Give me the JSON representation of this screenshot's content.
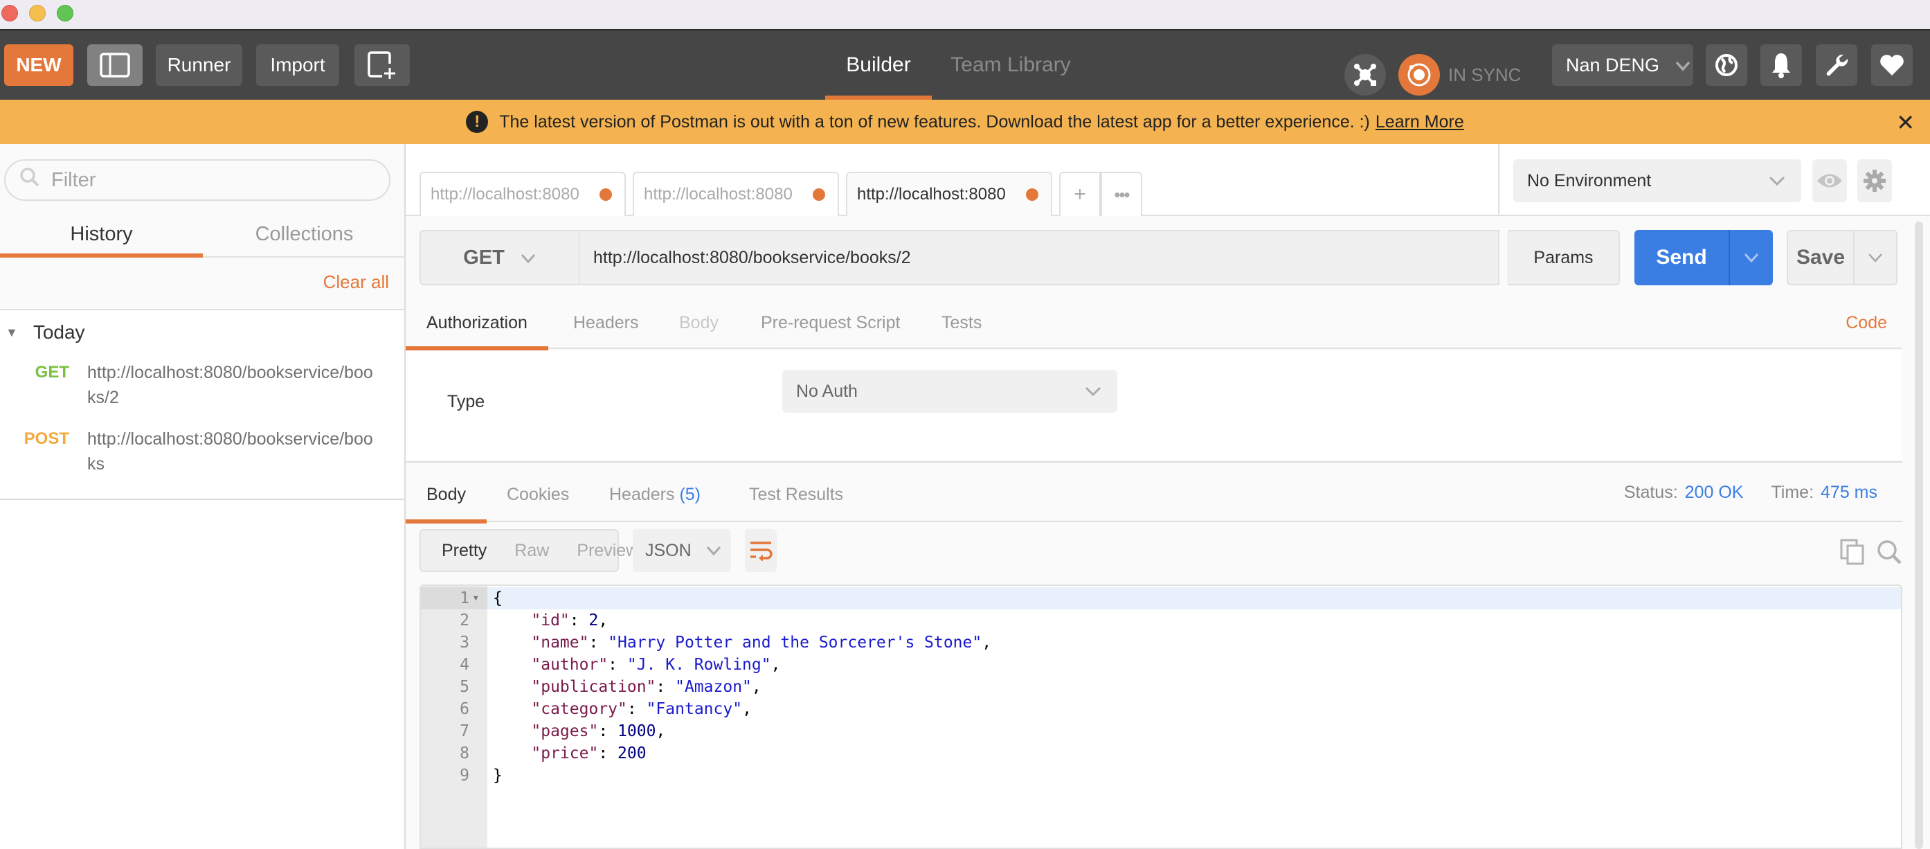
{
  "window": {
    "traffic_lights": [
      "close",
      "minimize",
      "maximize"
    ]
  },
  "toolbar": {
    "new_label": "NEW",
    "runner_label": "Runner",
    "import_label": "Import",
    "nav_tabs": [
      {
        "label": "Builder",
        "active": true
      },
      {
        "label": "Team Library",
        "active": false
      }
    ],
    "sync_status": "IN SYNC",
    "user_name": "Nan DENG",
    "icons": [
      "sidebar-toggle-icon",
      "new-window-icon",
      "interceptor-icon",
      "sync-icon",
      "globe-icon",
      "bell-icon",
      "wrench-icon",
      "heart-icon"
    ]
  },
  "banner": {
    "message": "The latest version of Postman is out with a ton of new features. Download the latest app for a better experience. :)",
    "link_label": "Learn More",
    "close_glyph": "✕",
    "warn_glyph": "!"
  },
  "sidebar": {
    "filter_placeholder": "Filter",
    "tabs": [
      {
        "label": "History",
        "active": true
      },
      {
        "label": "Collections",
        "active": false
      }
    ],
    "clear_all_label": "Clear all",
    "group_label": "Today",
    "history": [
      {
        "method": "GET",
        "url": "http://localhost:8080/bookservice/books/2"
      },
      {
        "method": "POST",
        "url": "http://localhost:8080/bookservice/books"
      }
    ]
  },
  "request_tabs": [
    {
      "label": "http://localhost:8080",
      "unsaved": true,
      "active": false
    },
    {
      "label": "http://localhost:8080",
      "unsaved": true,
      "active": false
    },
    {
      "label": "http://localhost:8080",
      "unsaved": true,
      "active": true
    }
  ],
  "tab_actions": {
    "add": "+",
    "more": "•••"
  },
  "environment": {
    "selected": "No Environment"
  },
  "request": {
    "method": "GET",
    "url": "http://localhost:8080/bookservice/books/2",
    "params_label": "Params",
    "send_label": "Send",
    "save_label": "Save",
    "tabs": [
      {
        "label": "Authorization",
        "state": "active"
      },
      {
        "label": "Headers",
        "state": "normal"
      },
      {
        "label": "Body",
        "state": "disabled"
      },
      {
        "label": "Pre-request Script",
        "state": "normal"
      },
      {
        "label": "Tests",
        "state": "normal"
      }
    ],
    "code_label": "Code",
    "auth": {
      "type_label": "Type",
      "type_value": "No Auth"
    }
  },
  "response": {
    "tabs": [
      {
        "label": "Body",
        "active": true,
        "count": null
      },
      {
        "label": "Cookies",
        "active": false,
        "count": null
      },
      {
        "label": "Headers",
        "active": false,
        "count": "(5)"
      },
      {
        "label": "Test Results",
        "active": false,
        "count": null
      }
    ],
    "status_label": "Status:",
    "status_value": "200 OK",
    "time_label": "Time:",
    "time_value": "475 ms",
    "format_options": [
      {
        "label": "Pretty",
        "active": true
      },
      {
        "label": "Raw",
        "active": false
      },
      {
        "label": "Preview",
        "active": false
      }
    ],
    "language": "JSON",
    "body_lines": [
      {
        "n": "1",
        "tokens": [
          {
            "t": "p",
            "v": "{"
          }
        ]
      },
      {
        "n": "2",
        "tokens": [
          {
            "t": "p",
            "v": "    "
          },
          {
            "t": "k",
            "v": "\"id\""
          },
          {
            "t": "p",
            "v": ": "
          },
          {
            "t": "n",
            "v": "2"
          },
          {
            "t": "p",
            "v": ","
          }
        ]
      },
      {
        "n": "3",
        "tokens": [
          {
            "t": "p",
            "v": "    "
          },
          {
            "t": "k",
            "v": "\"name\""
          },
          {
            "t": "p",
            "v": ": "
          },
          {
            "t": "s",
            "v": "\"Harry Potter and the Sorcerer's Stone\""
          },
          {
            "t": "p",
            "v": ","
          }
        ]
      },
      {
        "n": "4",
        "tokens": [
          {
            "t": "p",
            "v": "    "
          },
          {
            "t": "k",
            "v": "\"author\""
          },
          {
            "t": "p",
            "v": ": "
          },
          {
            "t": "s",
            "v": "\"J. K. Rowling\""
          },
          {
            "t": "p",
            "v": ","
          }
        ]
      },
      {
        "n": "5",
        "tokens": [
          {
            "t": "p",
            "v": "    "
          },
          {
            "t": "k",
            "v": "\"publication\""
          },
          {
            "t": "p",
            "v": ": "
          },
          {
            "t": "s",
            "v": "\"Amazon\""
          },
          {
            "t": "p",
            "v": ","
          }
        ]
      },
      {
        "n": "6",
        "tokens": [
          {
            "t": "p",
            "v": "    "
          },
          {
            "t": "k",
            "v": "\"category\""
          },
          {
            "t": "p",
            "v": ": "
          },
          {
            "t": "s",
            "v": "\"Fantancy\""
          },
          {
            "t": "p",
            "v": ","
          }
        ]
      },
      {
        "n": "7",
        "tokens": [
          {
            "t": "p",
            "v": "    "
          },
          {
            "t": "k",
            "v": "\"pages\""
          },
          {
            "t": "p",
            "v": ": "
          },
          {
            "t": "n",
            "v": "1000"
          },
          {
            "t": "p",
            "v": ","
          }
        ]
      },
      {
        "n": "8",
        "tokens": [
          {
            "t": "p",
            "v": "    "
          },
          {
            "t": "k",
            "v": "\"price\""
          },
          {
            "t": "p",
            "v": ": "
          },
          {
            "t": "n",
            "v": "200"
          }
        ]
      },
      {
        "n": "9",
        "tokens": [
          {
            "t": "p",
            "v": "}"
          }
        ]
      }
    ]
  },
  "colors": {
    "accent_orange": "#e4783a",
    "send_blue": "#3a7ee4",
    "banner": "#f4b350",
    "get_green": "#7ac143",
    "post_orange": "#f4a93f",
    "toolbar_bg": "#464646"
  }
}
